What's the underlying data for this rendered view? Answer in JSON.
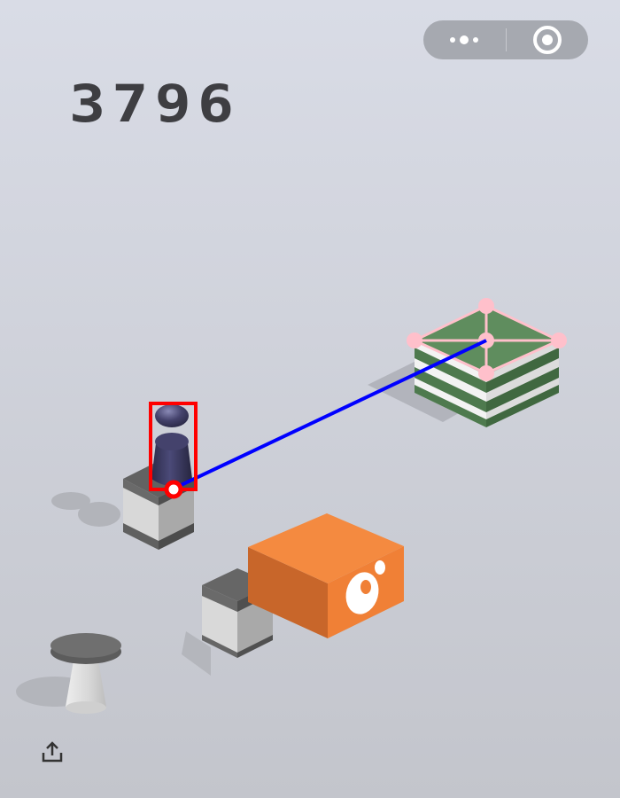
{
  "game": {
    "score": "3796"
  },
  "capsule": {
    "more_icon": "three-dots-icon",
    "close_icon": "target-circle-icon"
  },
  "footer": {
    "share_icon": "share-upload-icon"
  },
  "colors": {
    "background_top": "#d9dce6",
    "background_bottom": "#c3c5cc",
    "score": "#3e3e42",
    "target_block_green": "#5c8a5a",
    "orange_block": "#f08036",
    "player": "#3b3a5e",
    "overlay_box": "#ff0000",
    "overlay_line": "#0000ff",
    "overlay_markers": "#ffc0cb"
  }
}
